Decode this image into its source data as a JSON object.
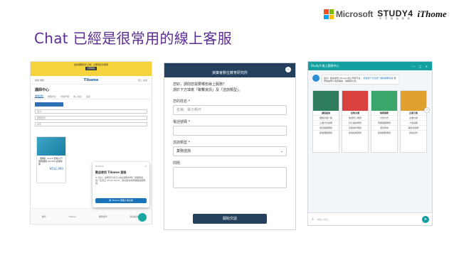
{
  "header": {
    "title": "Chat 已經是很常用的線上客服",
    "logos": {
      "microsoft": "Microsoft",
      "study4": "STUDY4",
      "study4_sub": "學 習 網 絡 服 務",
      "ithome": "iThome"
    },
    "microsoft_colors": [
      "#f25022",
      "#7fba00",
      "#00a4ef",
      "#ffb900"
    ]
  },
  "panel1": {
    "banner_text": "最新課程同步上線！立即報名享優惠",
    "banner_button": "立即報名",
    "nav_left": "講師 課程",
    "logo": "Tibame",
    "nav_right": "登入 註冊",
    "heading": "講師中心",
    "tabs": [
      "講師資料",
      "課程列表",
      "學員管理",
      "收入報表",
      "設定"
    ],
    "fields": [
      "搜尋",
      "課程類別",
      "排序"
    ],
    "card_text": "【課程】Azure 雲端入門實戰課程 AZ-900 認證準備",
    "card_price": "NT$1,990",
    "footer_items": [
      "關於",
      "Tibame",
      "服務條款",
      "隱私權政策"
    ],
    "chat": {
      "brand": "iThome",
      "title": "歡迎使用 Tibame 客服",
      "body": "Hi 您好，請問有什麼可以為您服務的嗎？客服時間：週一至週五 09:00-18:00，歡迎留言詢問課程相關問題。",
      "button": "與 Tibame 客服人員交談"
    }
  },
  "panel2": {
    "title": "資策會數位教育研究所",
    "minimize": "–",
    "intro": "您好，請問您需要哪些線上服務？\n請於下方填寫「聯繫資訊」及「諮詢類型」。",
    "label_name": "您的姓名 *",
    "name_placeholder": "名稱、電子郵件",
    "label_phone": "電話號碼 *",
    "label_type": "諮詢類型 *",
    "type_value": "業務諮詢",
    "label_note": "問題",
    "submit": "開始交談"
  },
  "panel3": {
    "title": "Study4 線上客服中心",
    "window_controls": "— □ ✕",
    "message_lead": "您好！歡迎來到 Study4 線上學習平台，",
    "message_link": "請選擇下方您想了解的服務項目",
    "message_body": "我們將由專人為您解答，請稍候片刻。",
    "cards": [
      {
        "name": "課程諮詢",
        "options": [
          "課程內容介紹",
          "上課方式說明",
          "報名相關問題",
          "其他課程問題"
        ],
        "color": "#2f7d5f"
      },
      {
        "name": "技術支援",
        "options": [
          "帳號登入問題",
          "影片播放問題",
          "系統操作問題",
          "其他技術問題"
        ],
        "color": "#d94141"
      },
      {
        "name": "帳務服務",
        "options": [
          "付款方式",
          "發票相關問題",
          "退款申請",
          "其他帳務問題"
        ],
        "color": "#3aa66b"
      },
      {
        "name": "企業方案",
        "options": [
          "企業內訓",
          "大量採購",
          "客製化服務",
          "其他合作"
        ],
        "color": "#e0a030"
      }
    ],
    "input_placeholder": "請輸入訊息...",
    "send_icon": "➤",
    "arrow": "›"
  }
}
